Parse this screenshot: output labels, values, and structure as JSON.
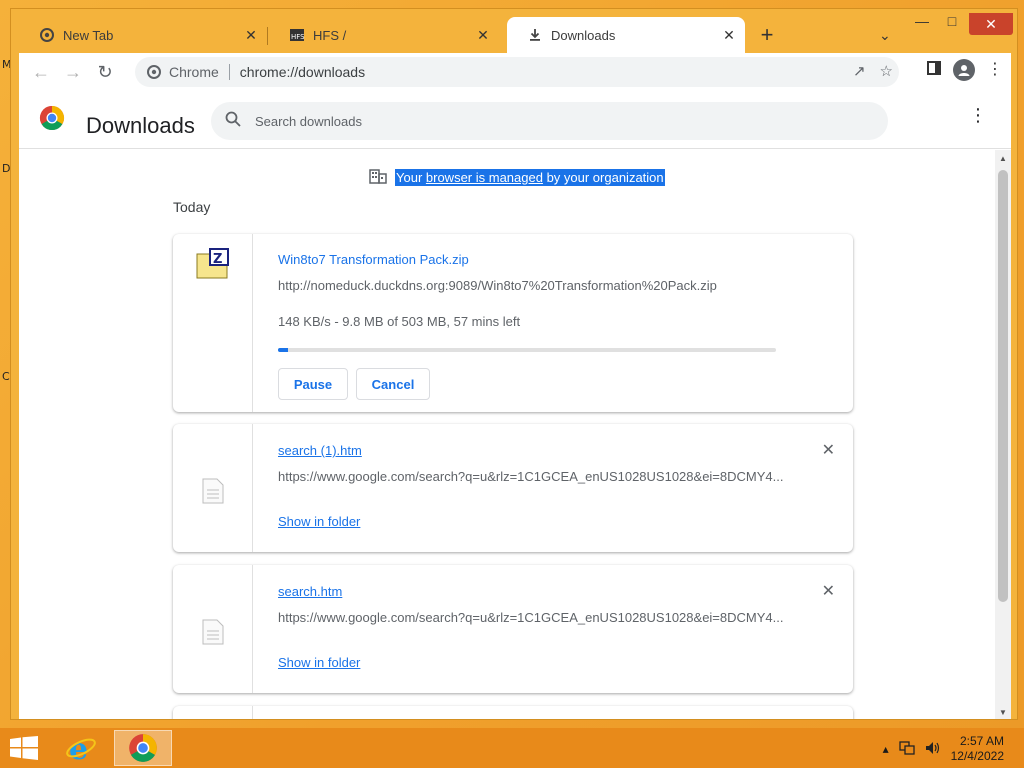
{
  "browser": {
    "tabs": [
      {
        "title": "New Tab",
        "icon": "chrome-icon"
      },
      {
        "title": "HFS /",
        "icon": "hfs-icon"
      },
      {
        "title": "Downloads",
        "icon": "download-icon",
        "active": true
      }
    ],
    "omnibox": {
      "chip": "Chrome",
      "url": "chrome://downloads"
    }
  },
  "downloads": {
    "title": "Downloads",
    "search_placeholder": "Search downloads",
    "managed_prefix": "Your ",
    "managed_link": "browser is managed",
    "managed_suffix": " by your organization",
    "date_group": "Today",
    "items": [
      {
        "name": "Win8to7 Transformation Pack.zip",
        "url": "http://nomeduck.duckdns.org:9089/Win8to7%20Transformation%20Pack.zip",
        "status": "148 KB/s - 9.8 MB of 503 MB, 57 mins left",
        "progress": 0.0195,
        "pause_label": "Pause",
        "cancel_label": "Cancel"
      },
      {
        "name": "search (1).htm",
        "url": "https://www.google.com/search?q=u&rlz=1C1GCEA_enUS1028US1028&ei=8DCMY4...",
        "show_label": "Show in folder"
      },
      {
        "name": "search.htm",
        "url": "https://www.google.com/search?q=u&rlz=1C1GCEA_enUS1028US1028&ei=8DCMY4...",
        "show_label": "Show in folder"
      }
    ]
  },
  "desktop": {
    "letters": [
      "M",
      "D",
      "C"
    ]
  },
  "taskbar": {
    "time": "2:57 AM",
    "date": "12/4/2022"
  },
  "colors": {
    "accent": "#1a73e8",
    "taskbar": "#e88a1a",
    "titlebar": "#f4b33c"
  }
}
